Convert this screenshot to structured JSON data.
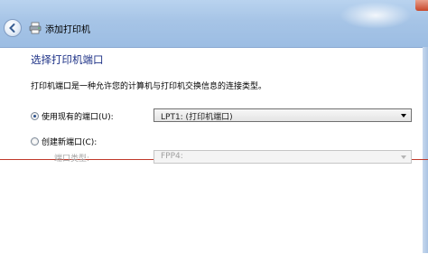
{
  "window": {
    "title": "添加打印机"
  },
  "page": {
    "heading": "选择打印机端口",
    "description": "打印机端口是一种允许您的计算机与打印机交换信息的连接类型。"
  },
  "options": {
    "existing_port": {
      "label": "使用现有的端口(U):",
      "selected": true,
      "dropdown_value": "LPT1: (打印机端口)"
    },
    "new_port": {
      "label": "创建新端口(C):",
      "selected": false,
      "type_label": "端口类型:",
      "dropdown_value": "FPP4:"
    }
  },
  "colors": {
    "heading": "#1e3287",
    "chrome": "#a6c4e6",
    "annotation_line": "#c0392b"
  }
}
